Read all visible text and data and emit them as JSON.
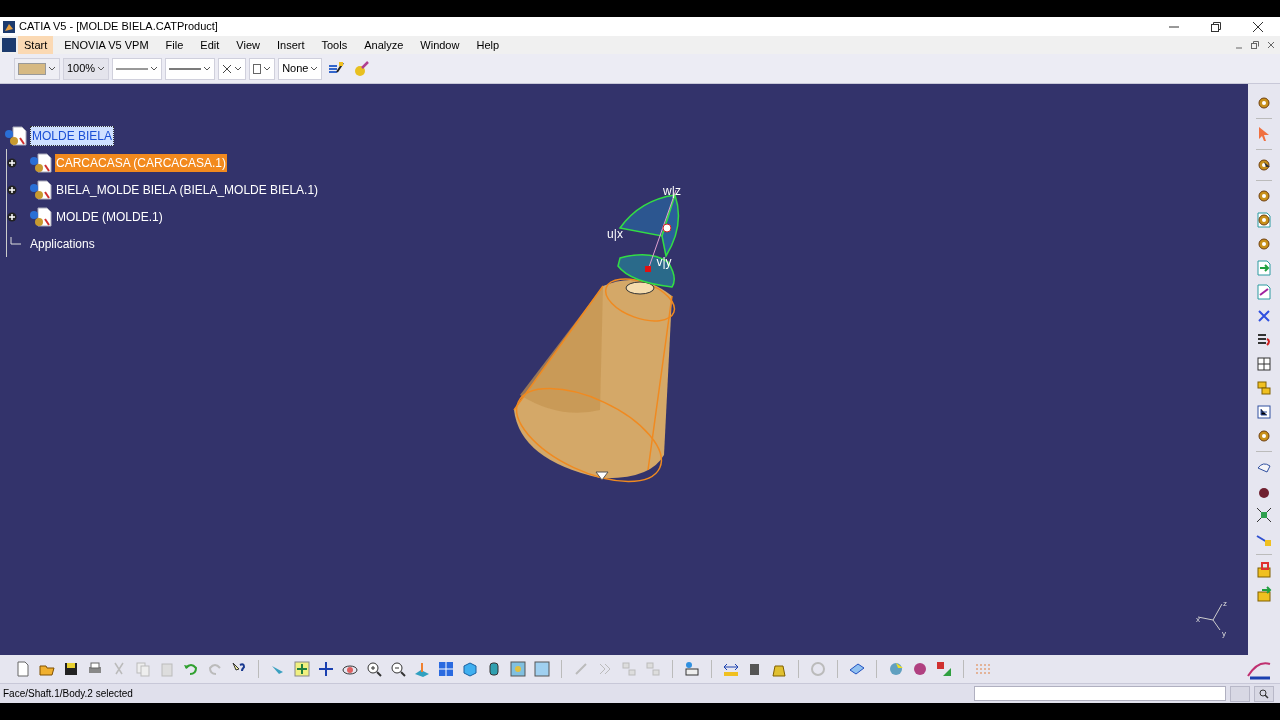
{
  "window": {
    "title": "CATIA V5 - [MOLDE BIELA.CATProduct]"
  },
  "menu": [
    {
      "label": "Start",
      "selected": true
    },
    {
      "label": "ENOVIA V5 VPM",
      "selected": false
    },
    {
      "label": "File",
      "selected": false
    },
    {
      "label": "Edit",
      "selected": false
    },
    {
      "label": "View",
      "selected": false
    },
    {
      "label": "Insert",
      "selected": false
    },
    {
      "label": "Tools",
      "selected": false
    },
    {
      "label": "Analyze",
      "selected": false
    },
    {
      "label": "Window",
      "selected": false
    },
    {
      "label": "Help",
      "selected": false
    }
  ],
  "graphic_properties": {
    "zoom": "100%",
    "layer": "None"
  },
  "tree": {
    "label": "MOLDE BIELA",
    "selected": true,
    "children": [
      {
        "label": "CARCACASA (CARCACASA.1)",
        "selected": false,
        "preselected": true,
        "expandable": true
      },
      {
        "label": "BIELA_MOLDE BIELA (BIELA_MOLDE BIELA.1)",
        "selected": false,
        "preselected": false,
        "expandable": true
      },
      {
        "label": "MOLDE (MOLDE.1)",
        "selected": false,
        "preselected": false,
        "expandable": true
      },
      {
        "label": "Applications",
        "selected": false,
        "preselected": false,
        "expandable": false
      }
    ]
  },
  "compass": {
    "axes": [
      "w|z",
      "u|x",
      "v|y"
    ]
  },
  "axis_triad": {
    "labels": [
      "z",
      "x",
      "y"
    ]
  },
  "status_bar": {
    "message": "Face/Shaft.1/Body.2 selected"
  }
}
